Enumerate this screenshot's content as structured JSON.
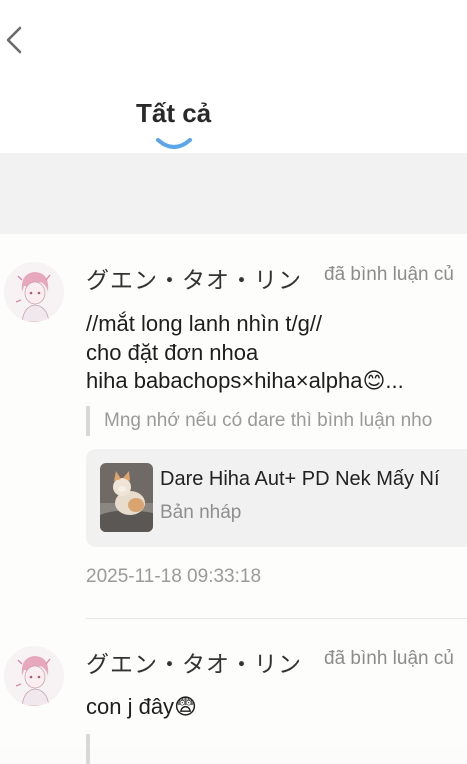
{
  "tabs": [
    {
      "label": "Tất cả",
      "active": true
    }
  ],
  "colors": {
    "accent": "#5aa6e8",
    "background": "#fcfcfb",
    "band": "#f2f2f2",
    "card": "#f1f1f1"
  },
  "comments": [
    {
      "username": "グエン・タオ・リン",
      "action": "đã bình luận củ",
      "content_lines": [
        "//mắt long lanh nhìn t/g//",
        "cho đặt đơn nhoa",
        "hiha babachops×hiha×alpha😊..."
      ],
      "quote": "Mng nhớ nếu có dare thì bình luận nho",
      "story": {
        "title": "Dare Hiha Aut+ PD Nek Mấy Ní",
        "status": "Bản nháp"
      },
      "timestamp": "2025-11-18 09:33:18"
    },
    {
      "username": "グエン・タオ・リン",
      "action": "đã bình luận củ",
      "content_lines": [
        "con j đây😨"
      ]
    }
  ]
}
